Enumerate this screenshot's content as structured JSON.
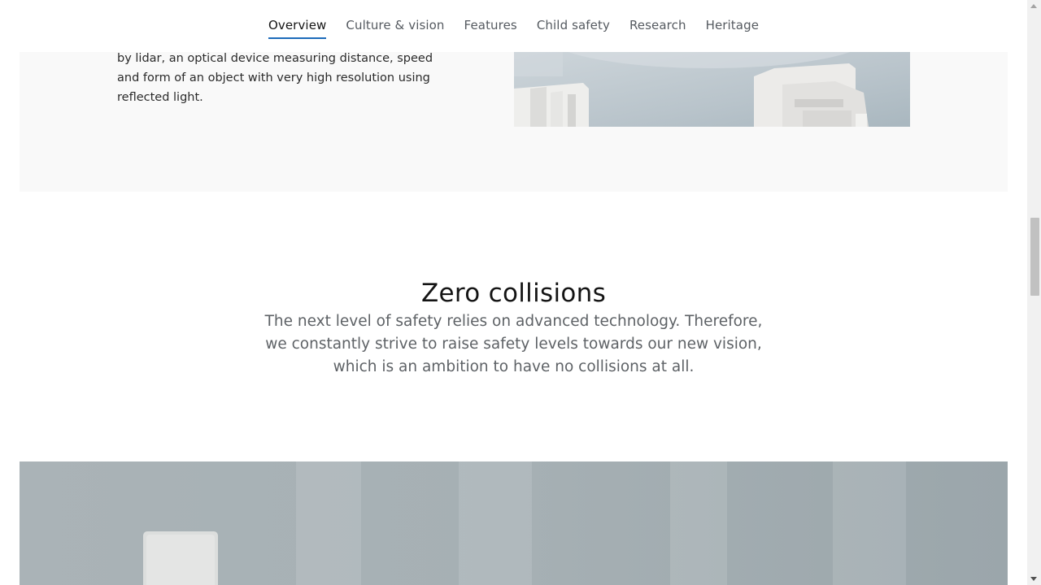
{
  "nav": {
    "tabs": [
      {
        "label": "Overview",
        "active": true
      },
      {
        "label": "Culture & vision",
        "active": false
      },
      {
        "label": "Features",
        "active": false
      },
      {
        "label": "Child safety",
        "active": false
      },
      {
        "label": "Research",
        "active": false
      },
      {
        "label": "Heritage",
        "active": false
      }
    ],
    "active_underline_color": "#1c6bba"
  },
  "upper_section": {
    "body_text": "by lidar, an optical device measuring distance, speed and form of an object with very high resolution using reflected light."
  },
  "zero_collisions": {
    "title": "Zero collisions",
    "description": "The next level of safety relies on advanced technology. Therefore, we constantly strive to raise safety levels towards our new vision, which is an ambition to have no collisions at all."
  },
  "colors": {
    "upper_section_bg": "#f9f9f9",
    "title_text": "#141414",
    "description_text": "#5e6266"
  }
}
